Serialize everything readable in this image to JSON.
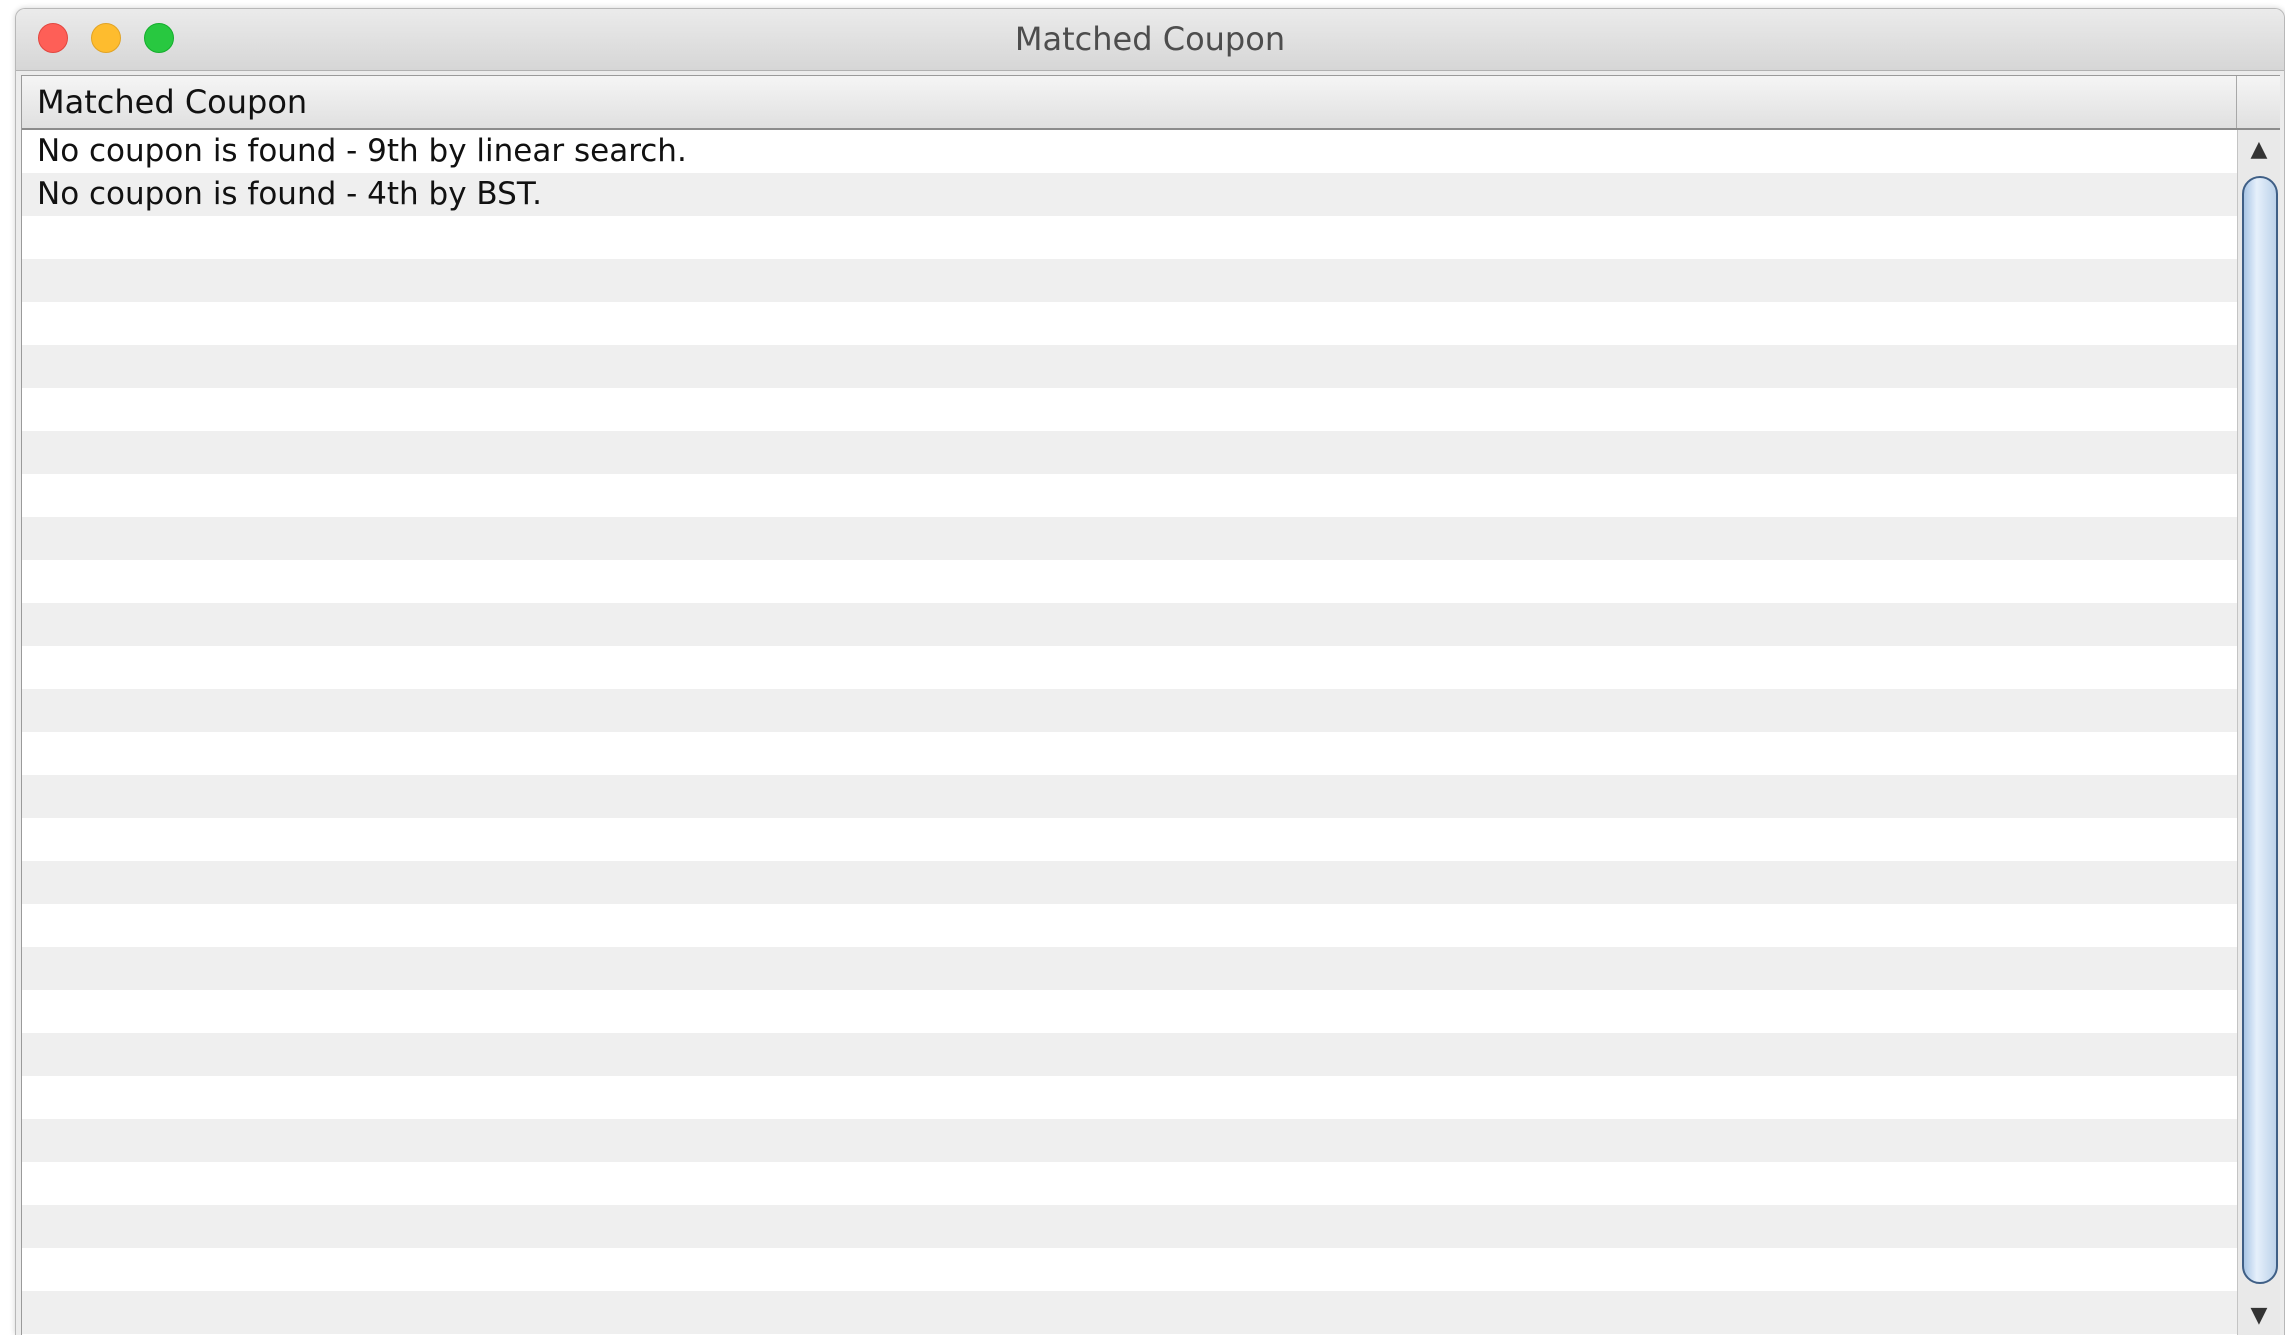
{
  "window": {
    "title": "Matched Coupon"
  },
  "table": {
    "columns": [
      "Matched Coupon"
    ],
    "rows": [
      "No coupon is found - 9th by linear search.",
      "No coupon is found - 4th by BST."
    ],
    "empty_row_count": 26
  },
  "scrollbar": {
    "up_arrow": "▲",
    "down_arrow": "▼"
  },
  "colors": {
    "close": "#fe5f57",
    "minimize": "#febc2e",
    "maximize": "#28c840",
    "stripe": "#efefef"
  }
}
